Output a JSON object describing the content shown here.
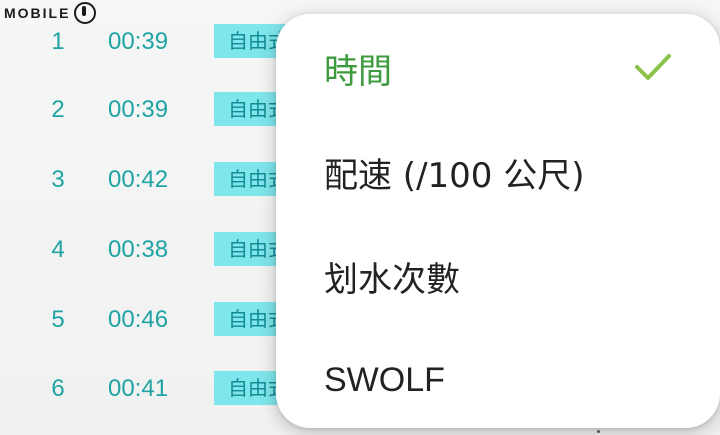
{
  "watermark": {
    "text": "MOBILE"
  },
  "laps": [
    {
      "num": "1",
      "time": "00:39",
      "stroke": "自由式"
    },
    {
      "num": "2",
      "time": "00:39",
      "stroke": "自由式"
    },
    {
      "num": "3",
      "time": "00:42",
      "stroke": "自由式"
    },
    {
      "num": "4",
      "time": "00:38",
      "stroke": "自由式"
    },
    {
      "num": "5",
      "time": "00:46",
      "stroke": "自由式"
    },
    {
      "num": "6",
      "time": "00:41",
      "stroke": "自由式"
    }
  ],
  "menu": {
    "items": [
      {
        "label": "時間",
        "selected": true
      },
      {
        "label": "配速 (/100 公尺)",
        "selected": false
      },
      {
        "label": "划水次數",
        "selected": false
      },
      {
        "label": "SWOLF",
        "selected": false
      }
    ]
  },
  "colors": {
    "accent_teal": "#1fa3a3",
    "stroke_badge": "#7fe6ec",
    "selected_green": "#3d9a3d"
  },
  "icons": {
    "selected_indicator": "checkmark-icon"
  }
}
